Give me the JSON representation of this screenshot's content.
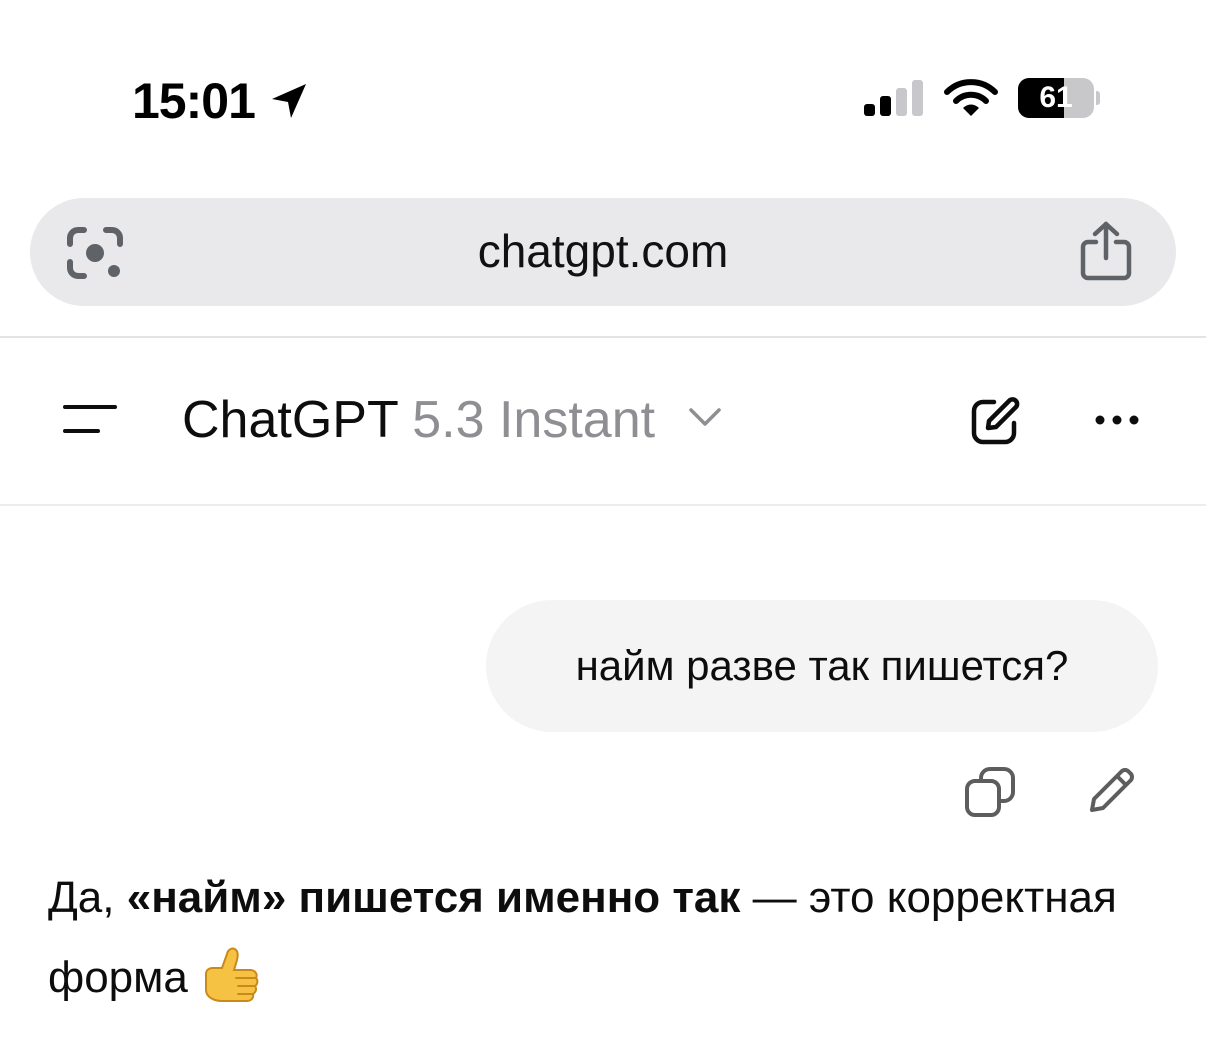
{
  "status_bar": {
    "time": "15:01",
    "battery_level": "61",
    "battery_fraction": 0.61
  },
  "browser": {
    "url": "chatgpt.com"
  },
  "header": {
    "title": "ChatGPT",
    "model": "5.3 Instant"
  },
  "conversation": {
    "user_message": "найм разве так пишется?",
    "assistant": {
      "part1": "Да, ",
      "bold": "«найм» пишется именно так",
      "part2": " — это корректная форма",
      "emoji": "thumbs-up"
    }
  },
  "icons": {
    "location": "location-arrow-icon",
    "signal": "cellular-signal-icon",
    "wifi": "wifi-icon",
    "lens": "google-lens-icon",
    "share": "share-icon",
    "menu": "sidebar-menu-icon",
    "chevron": "chevron-down-icon",
    "new_chat": "new-chat-icon",
    "more": "more-icon",
    "copy": "copy-icon",
    "edit": "edit-pencil-icon"
  },
  "colors": {
    "url_bar_bg": "#e9e9eb",
    "bubble_bg": "#f4f4f4",
    "model_text": "#8e8e93",
    "text": "#0d0d0d"
  }
}
